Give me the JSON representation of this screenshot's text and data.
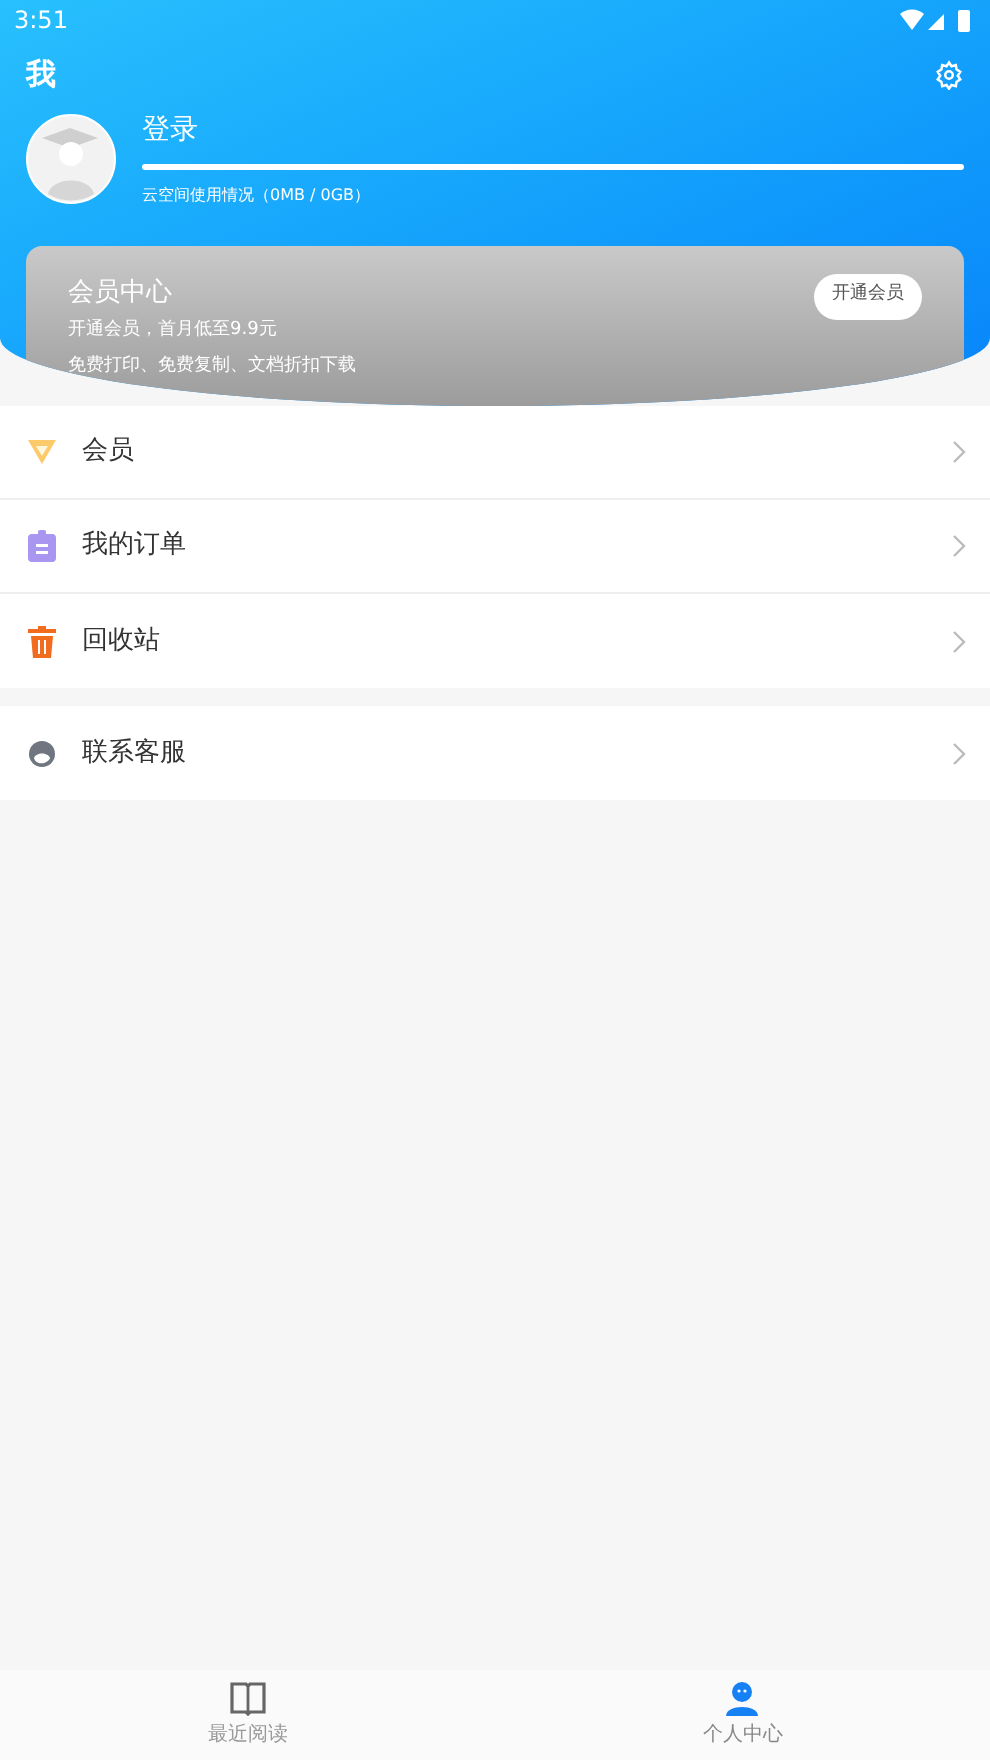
{
  "status_bar": {
    "time": "3:51"
  },
  "header": {
    "title": "我",
    "login": "登录",
    "storage": "云空间使用情况（0MB / 0GB）"
  },
  "member_card": {
    "title": "会员中心",
    "line_1": "开通会员，首月低至9.9元",
    "line_2": "免费打印、免费复制、文档折扣下载",
    "button": "开通会员"
  },
  "menu_groups": [
    [
      {
        "kind": "diamond",
        "label": "会员"
      },
      {
        "kind": "clipboard",
        "label": "我的订单"
      },
      {
        "kind": "trash",
        "label": "回收站"
      }
    ],
    [
      {
        "kind": "agent",
        "label": "联系客服"
      }
    ]
  ],
  "tabs": [
    {
      "kind": "book",
      "label": "最近阅读",
      "selected": false
    },
    {
      "kind": "person",
      "label": "个人中心",
      "selected": true
    }
  ]
}
